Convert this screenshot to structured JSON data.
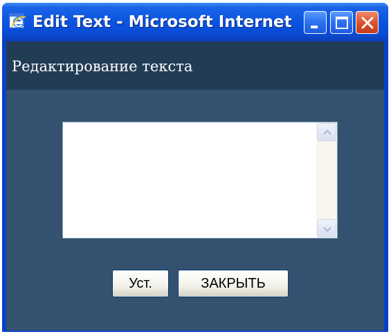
{
  "window": {
    "title": "Edit Text - Microsoft Internet E...",
    "icon": "internet-explorer-icon",
    "caption_buttons": [
      "minimize-icon",
      "maximize-icon",
      "close-icon"
    ]
  },
  "header": {
    "title": "Редактирование текста"
  },
  "editor": {
    "value": "",
    "placeholder": ""
  },
  "buttons": {
    "set_label": "Уст.",
    "close_label": "ЗАКРЫТЬ"
  },
  "colors": {
    "titlebar": "#0a54df",
    "header_band": "#233c56",
    "body": "#34526f",
    "close_button": "#e0552f"
  }
}
